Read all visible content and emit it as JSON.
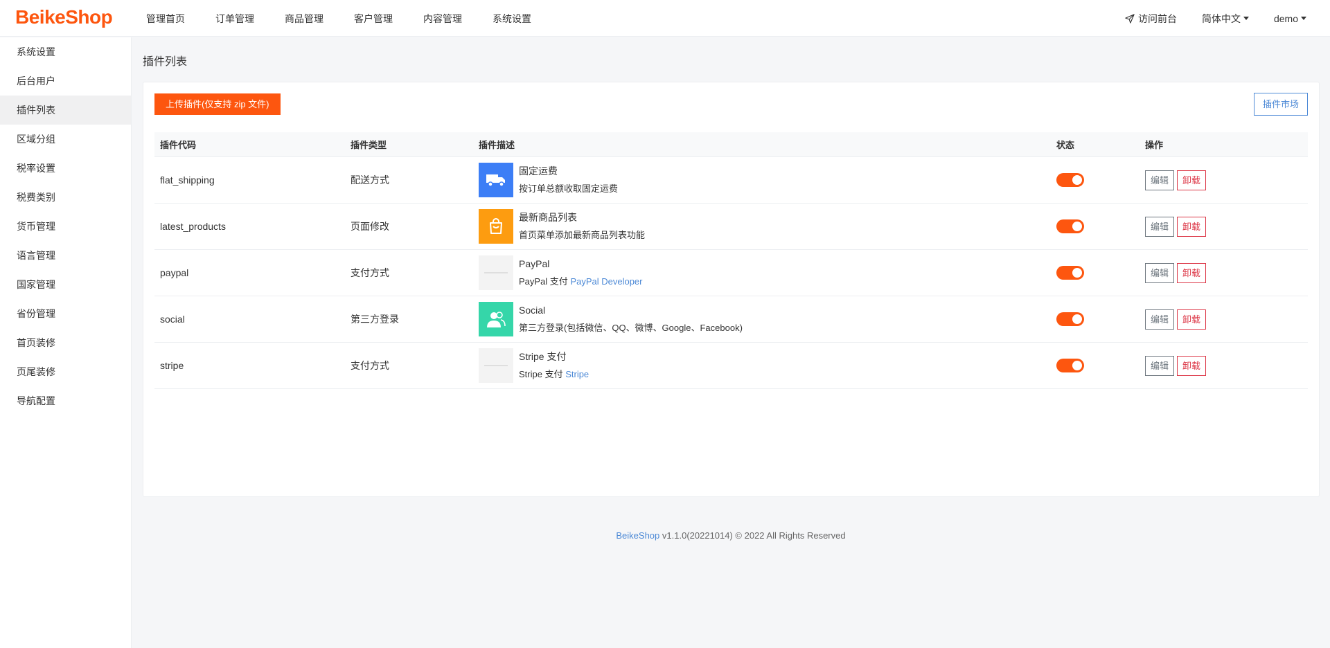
{
  "header": {
    "logo": "BeikeShop",
    "nav": [
      "管理首页",
      "订单管理",
      "商品管理",
      "客户管理",
      "内容管理",
      "系统设置"
    ],
    "visit_frontend": "访问前台",
    "language": "简体中文",
    "user": "demo"
  },
  "sidebar": {
    "items": [
      "系统设置",
      "后台用户",
      "插件列表",
      "区域分组",
      "税率设置",
      "税费类别",
      "货币管理",
      "语言管理",
      "国家管理",
      "省份管理",
      "首页装修",
      "页尾装修",
      "导航配置"
    ]
  },
  "page": {
    "title": "插件列表",
    "upload_label": "上传插件(仅支持 zip 文件)",
    "market_label": "插件市场"
  },
  "table": {
    "headers": {
      "code": "插件代码",
      "type": "插件类型",
      "desc": "插件描述",
      "status": "状态",
      "ops": "操作"
    },
    "edit_label": "编辑",
    "uninstall_label": "卸载",
    "rows": [
      {
        "code": "flat_shipping",
        "type": "配送方式",
        "name": "固定运费",
        "sub": "按订单总额收取固定运费",
        "link": ""
      },
      {
        "code": "latest_products",
        "type": "页面修改",
        "name": "最新商品列表",
        "sub": "首页菜单添加最新商品列表功能",
        "link": ""
      },
      {
        "code": "paypal",
        "type": "支付方式",
        "name": "PayPal",
        "sub": "PayPal 支付",
        "link": "PayPal Developer"
      },
      {
        "code": "social",
        "type": "第三方登录",
        "name": "Social",
        "sub": "第三方登录(包括微信、QQ、微博、Google、Facebook)",
        "link": ""
      },
      {
        "code": "stripe",
        "type": "支付方式",
        "name": "Stripe 支付",
        "sub": "Stripe 支付",
        "link": "Stripe"
      }
    ]
  },
  "footer": {
    "brand": "BeikeShop",
    "text": "v1.1.0(20221014) © 2022 All Rights Reserved"
  },
  "colors": {
    "accent": "#fd560f",
    "link": "#4c89d6",
    "danger": "#dc3545",
    "icon_blue": "#3c7ef6",
    "icon_orange": "#fd9c10",
    "icon_green": "#35d6a9"
  }
}
